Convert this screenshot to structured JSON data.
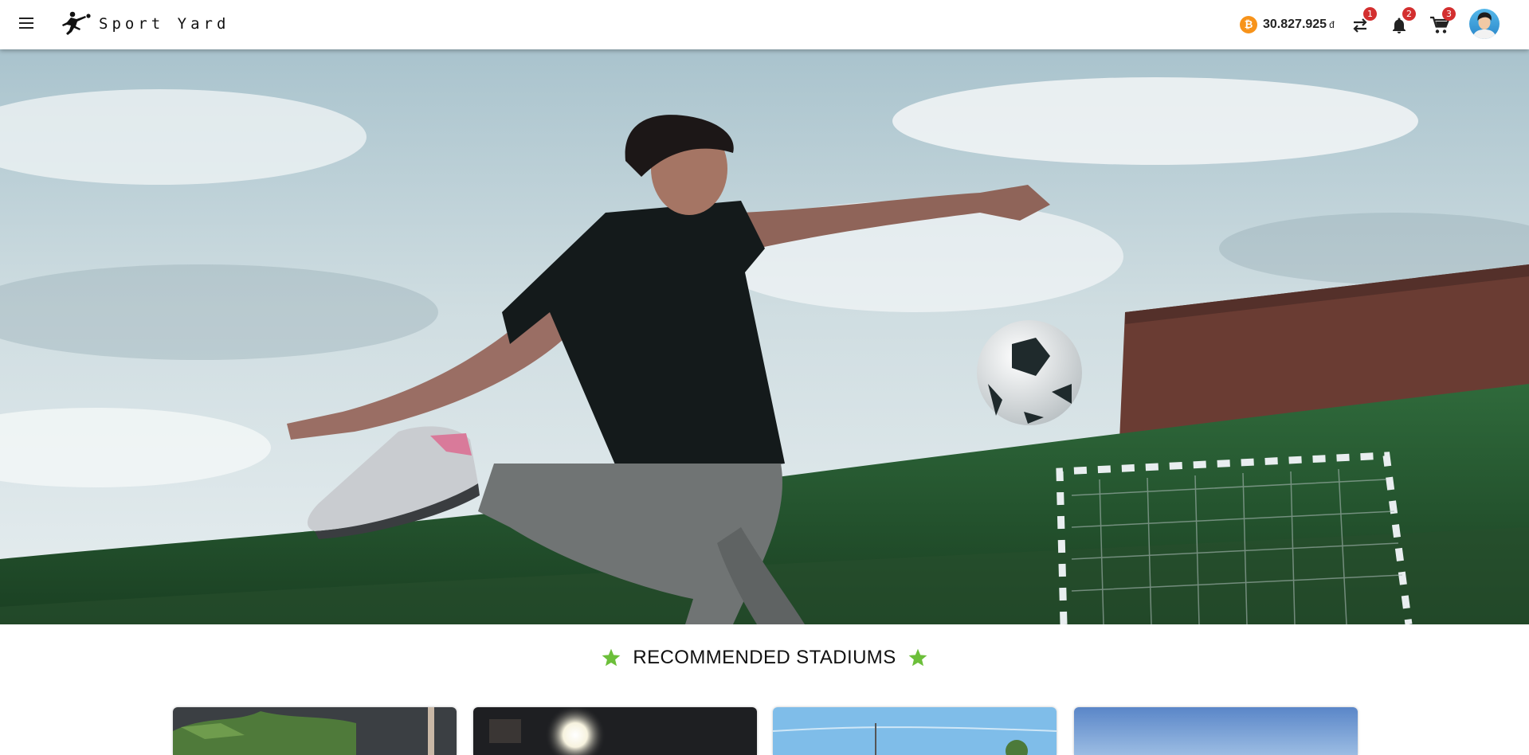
{
  "header": {
    "brand": "Sport Yard",
    "balance": "30.827.925",
    "currency": "đ",
    "coin_symbol": "₿",
    "transfer_count": "1",
    "notification_count": "2",
    "cart_count": "3"
  },
  "main": {
    "section_title": "RECOMMENDED STADIUMS"
  },
  "colors": {
    "badge": "#d32f2f",
    "coin": "#f7931a",
    "star": "#6cbf3a"
  },
  "icons": [
    "menu-icon",
    "soccer-player-logo-icon",
    "bitcoin-icon",
    "transfer-icon",
    "bell-icon",
    "cart-icon",
    "star-icon"
  ]
}
